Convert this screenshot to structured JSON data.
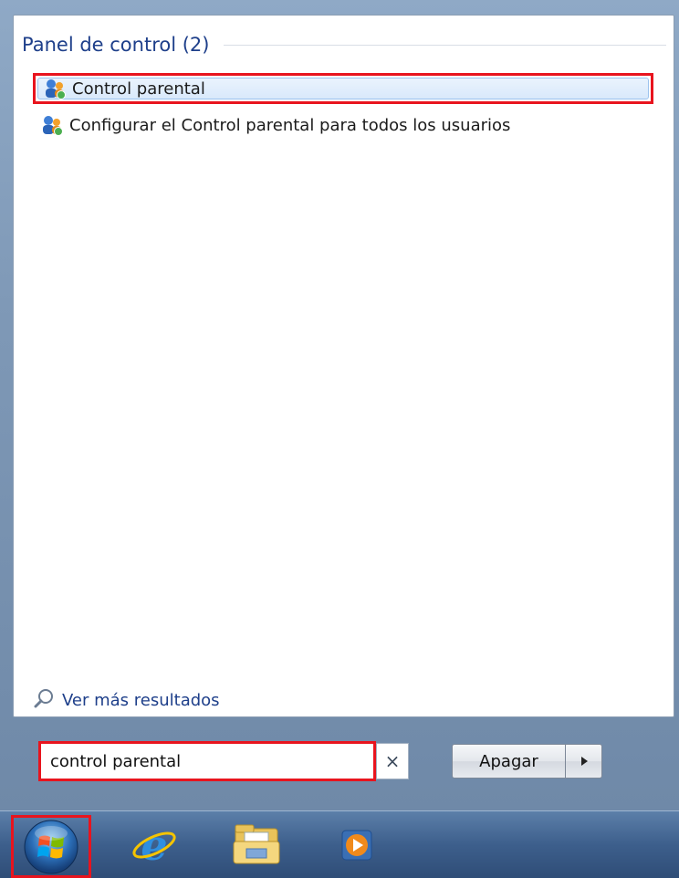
{
  "start_menu": {
    "group_title": "Panel de control (2)",
    "results": [
      {
        "label": "Control parental",
        "icon": "parental-controls-icon",
        "highlighted": true
      },
      {
        "label": "Configurar el Control parental para todos los usuarios",
        "icon": "parental-controls-icon",
        "highlighted": false
      }
    ],
    "more_results_label": "Ver más resultados",
    "more_results_icon": "search-icon"
  },
  "search": {
    "value": "control parental",
    "clear_label": "×"
  },
  "shutdown": {
    "label": "Apagar",
    "arrow_icon": "triangle-right-icon"
  },
  "taskbar": {
    "items": [
      {
        "icon": "windows-start-orb-icon"
      },
      {
        "icon": "internet-explorer-icon"
      },
      {
        "icon": "file-explorer-icon"
      },
      {
        "icon": "media-player-icon"
      }
    ]
  },
  "colors": {
    "annotation_red": "#e8141e",
    "header_blue": "#1e3f8a",
    "highlight_fill": "#d9e9fb"
  }
}
